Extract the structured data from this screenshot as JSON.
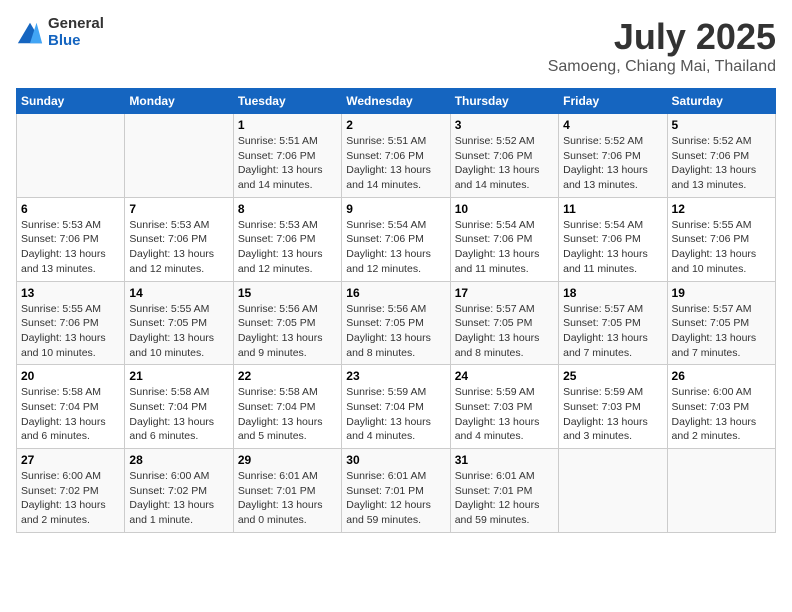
{
  "header": {
    "logo": {
      "general": "General",
      "blue": "Blue"
    },
    "title": "July 2025",
    "subtitle": "Samoeng, Chiang Mai, Thailand"
  },
  "weekdays": [
    "Sunday",
    "Monday",
    "Tuesday",
    "Wednesday",
    "Thursday",
    "Friday",
    "Saturday"
  ],
  "weeks": [
    [
      {
        "day": "",
        "info": ""
      },
      {
        "day": "",
        "info": ""
      },
      {
        "day": "1",
        "info": "Sunrise: 5:51 AM\nSunset: 7:06 PM\nDaylight: 13 hours\nand 14 minutes."
      },
      {
        "day": "2",
        "info": "Sunrise: 5:51 AM\nSunset: 7:06 PM\nDaylight: 13 hours\nand 14 minutes."
      },
      {
        "day": "3",
        "info": "Sunrise: 5:52 AM\nSunset: 7:06 PM\nDaylight: 13 hours\nand 14 minutes."
      },
      {
        "day": "4",
        "info": "Sunrise: 5:52 AM\nSunset: 7:06 PM\nDaylight: 13 hours\nand 13 minutes."
      },
      {
        "day": "5",
        "info": "Sunrise: 5:52 AM\nSunset: 7:06 PM\nDaylight: 13 hours\nand 13 minutes."
      }
    ],
    [
      {
        "day": "6",
        "info": "Sunrise: 5:53 AM\nSunset: 7:06 PM\nDaylight: 13 hours\nand 13 minutes."
      },
      {
        "day": "7",
        "info": "Sunrise: 5:53 AM\nSunset: 7:06 PM\nDaylight: 13 hours\nand 12 minutes."
      },
      {
        "day": "8",
        "info": "Sunrise: 5:53 AM\nSunset: 7:06 PM\nDaylight: 13 hours\nand 12 minutes."
      },
      {
        "day": "9",
        "info": "Sunrise: 5:54 AM\nSunset: 7:06 PM\nDaylight: 13 hours\nand 12 minutes."
      },
      {
        "day": "10",
        "info": "Sunrise: 5:54 AM\nSunset: 7:06 PM\nDaylight: 13 hours\nand 11 minutes."
      },
      {
        "day": "11",
        "info": "Sunrise: 5:54 AM\nSunset: 7:06 PM\nDaylight: 13 hours\nand 11 minutes."
      },
      {
        "day": "12",
        "info": "Sunrise: 5:55 AM\nSunset: 7:06 PM\nDaylight: 13 hours\nand 10 minutes."
      }
    ],
    [
      {
        "day": "13",
        "info": "Sunrise: 5:55 AM\nSunset: 7:06 PM\nDaylight: 13 hours\nand 10 minutes."
      },
      {
        "day": "14",
        "info": "Sunrise: 5:55 AM\nSunset: 7:05 PM\nDaylight: 13 hours\nand 10 minutes."
      },
      {
        "day": "15",
        "info": "Sunrise: 5:56 AM\nSunset: 7:05 PM\nDaylight: 13 hours\nand 9 minutes."
      },
      {
        "day": "16",
        "info": "Sunrise: 5:56 AM\nSunset: 7:05 PM\nDaylight: 13 hours\nand 8 minutes."
      },
      {
        "day": "17",
        "info": "Sunrise: 5:57 AM\nSunset: 7:05 PM\nDaylight: 13 hours\nand 8 minutes."
      },
      {
        "day": "18",
        "info": "Sunrise: 5:57 AM\nSunset: 7:05 PM\nDaylight: 13 hours\nand 7 minutes."
      },
      {
        "day": "19",
        "info": "Sunrise: 5:57 AM\nSunset: 7:05 PM\nDaylight: 13 hours\nand 7 minutes."
      }
    ],
    [
      {
        "day": "20",
        "info": "Sunrise: 5:58 AM\nSunset: 7:04 PM\nDaylight: 13 hours\nand 6 minutes."
      },
      {
        "day": "21",
        "info": "Sunrise: 5:58 AM\nSunset: 7:04 PM\nDaylight: 13 hours\nand 6 minutes."
      },
      {
        "day": "22",
        "info": "Sunrise: 5:58 AM\nSunset: 7:04 PM\nDaylight: 13 hours\nand 5 minutes."
      },
      {
        "day": "23",
        "info": "Sunrise: 5:59 AM\nSunset: 7:04 PM\nDaylight: 13 hours\nand 4 minutes."
      },
      {
        "day": "24",
        "info": "Sunrise: 5:59 AM\nSunset: 7:03 PM\nDaylight: 13 hours\nand 4 minutes."
      },
      {
        "day": "25",
        "info": "Sunrise: 5:59 AM\nSunset: 7:03 PM\nDaylight: 13 hours\nand 3 minutes."
      },
      {
        "day": "26",
        "info": "Sunrise: 6:00 AM\nSunset: 7:03 PM\nDaylight: 13 hours\nand 2 minutes."
      }
    ],
    [
      {
        "day": "27",
        "info": "Sunrise: 6:00 AM\nSunset: 7:02 PM\nDaylight: 13 hours\nand 2 minutes."
      },
      {
        "day": "28",
        "info": "Sunrise: 6:00 AM\nSunset: 7:02 PM\nDaylight: 13 hours\nand 1 minute."
      },
      {
        "day": "29",
        "info": "Sunrise: 6:01 AM\nSunset: 7:01 PM\nDaylight: 13 hours\nand 0 minutes."
      },
      {
        "day": "30",
        "info": "Sunrise: 6:01 AM\nSunset: 7:01 PM\nDaylight: 12 hours\nand 59 minutes."
      },
      {
        "day": "31",
        "info": "Sunrise: 6:01 AM\nSunset: 7:01 PM\nDaylight: 12 hours\nand 59 minutes."
      },
      {
        "day": "",
        "info": ""
      },
      {
        "day": "",
        "info": ""
      }
    ]
  ]
}
